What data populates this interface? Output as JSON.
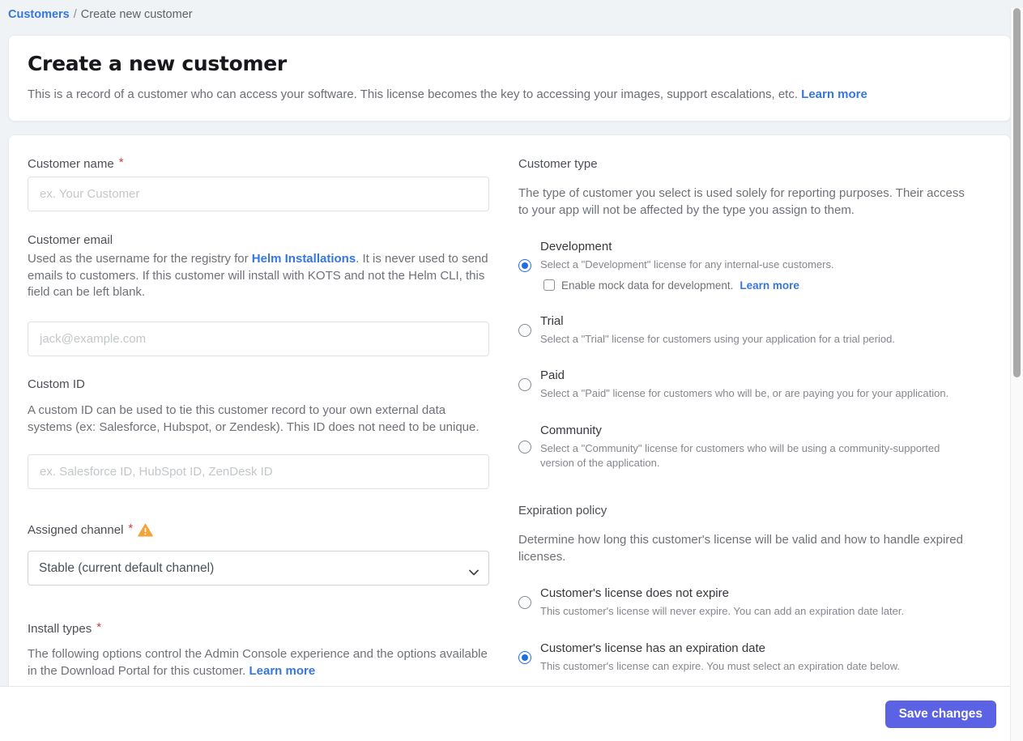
{
  "colors": {
    "link_blue": "#3677dd",
    "radio_selected_blue": "#1f6fe0",
    "save_button_indigo": "#5b62e3",
    "warning_orange": "#f2a437",
    "required_red": "#cc3d40"
  },
  "breadcrumb": {
    "link": "Customers",
    "separator": "/",
    "current": "Create new customer"
  },
  "header": {
    "title": "Create a new customer",
    "description": "This is a record of a customer who can access your software. This license becomes the key to accessing your images, support escalations, etc.",
    "learn_more": "Learn more"
  },
  "form": {
    "customer_name": {
      "label": "Customer name",
      "required_mark": "*",
      "placeholder": "ex. Your Customer",
      "value": ""
    },
    "customer_email": {
      "label": "Customer email",
      "description_before_link": "Used as the username for the registry for ",
      "description_link": "Helm Installations",
      "description_after_link": ". It is never used to send emails to customers. If this customer will install with KOTS and not the Helm CLI, this field can be left blank.",
      "placeholder": "jack@example.com",
      "value": ""
    },
    "custom_id": {
      "label": "Custom ID",
      "description": "A custom ID can be used to tie this customer record to your own external data systems (ex: Salesforce, Hubspot, or Zendesk). This ID does not need to be unique.",
      "placeholder": "ex. Salesforce ID, HubSpot ID, ZenDesk ID",
      "value": ""
    },
    "assigned_channel": {
      "label": "Assigned channel",
      "required_mark": "*",
      "value": "Stable (current default channel)"
    },
    "install_types": {
      "label": "Install types",
      "required_mark": "*",
      "description": "The following options control the Admin Console experience and the options available in the Download Portal for this customer.",
      "learn_more": "Learn more"
    }
  },
  "customer_type": {
    "heading": "Customer type",
    "description": "The type of customer you select is used solely for reporting purposes. Their access to your app will not be affected by the type you assign to them.",
    "options": [
      {
        "title": "Development",
        "description": "Select a \"Development\" license for any internal-use customers.",
        "selected": true
      },
      {
        "title": "Trial",
        "description": "Select a \"Trial\" license for customers using your application for a trial period.",
        "selected": false
      },
      {
        "title": "Paid",
        "description": "Select a \"Paid\" license for customers who will be, or are paying you for your application.",
        "selected": false
      },
      {
        "title": "Community",
        "description": "Select a \"Community\" license for customers who will be using a community-supported version of the application.",
        "selected": false
      }
    ],
    "mock_data": {
      "label": "Enable mock data for development.",
      "learn_more": "Learn more",
      "checked": false
    }
  },
  "expiration_policy": {
    "heading": "Expiration policy",
    "description": "Determine how long this customer's license will be valid and how to handle expired licenses.",
    "options": [
      {
        "title": "Customer's license does not expire",
        "description": "This customer's license will never expire. You can add an expiration date later.",
        "selected": false
      },
      {
        "title": "Customer's license has an expiration date",
        "description": "This customer's license can expire. You must select an expiration date below.",
        "selected": true
      }
    ]
  },
  "footer": {
    "save_label": "Save changes"
  }
}
